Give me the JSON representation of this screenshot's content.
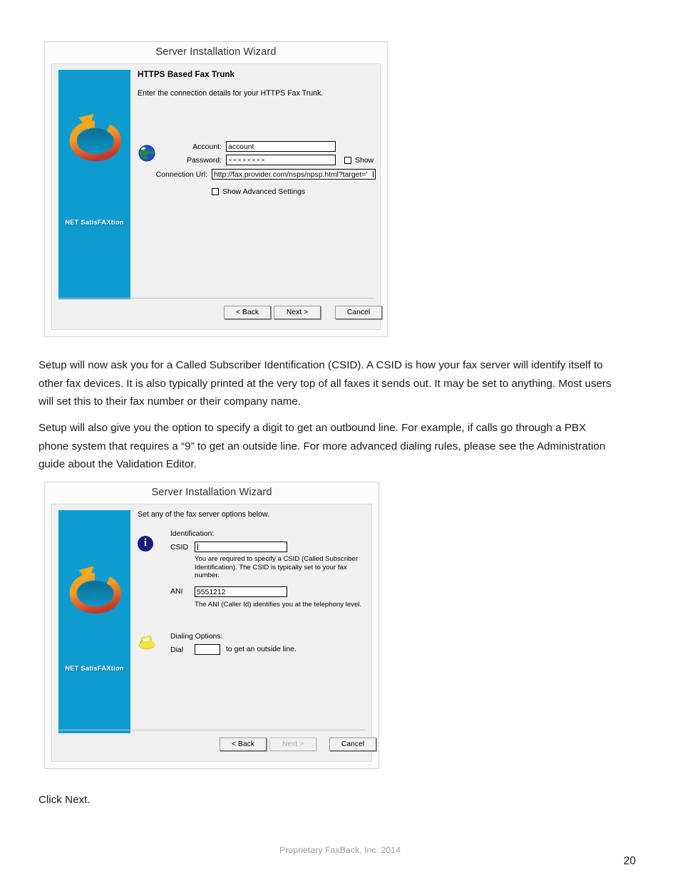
{
  "document": {
    "paragraph_1": "Setup will now ask you for a Called Subscriber Identification (CSID). A CSID is how your fax server will identify itself to other fax devices. It is also typically printed at the very top of all faxes it sends out. It may be set to anything. Most users will set this to their fax number or their company name.",
    "paragraph_2": "Setup will also give you the option to specify a digit to get an outbound line. For example, if calls go through a PBX phone system that requires a “9” to get an outside line. For more advanced dialing rules, please see the Administration guide about the Validation Editor.",
    "paragraph_3": "Click Next.",
    "footer": "Proprietary FaxBack, Inc. 2014",
    "page_number": "20"
  },
  "brand": {
    "name": "NET SatisFAXtion",
    "panel_color": "#0d9bd0",
    "logo_color_start": "#f5a623",
    "logo_color_end": "#c0392b"
  },
  "wizard_1": {
    "title": "Server Installation Wizard",
    "heading": "HTTPS Based Fax Trunk",
    "description": "Enter the connection details for your HTTPS Fax Trunk.",
    "icon": "globe-icon",
    "fields": {
      "account_label": "Account:",
      "account_value": "account",
      "password_label": "Password:",
      "password_value": "××××××××",
      "show_label": "Show",
      "show_checked": false,
      "connection_url_label": "Connection Url:",
      "connection_url_value": "http://fax.provider.com/nsps/npsp.html?target='",
      "advanced_label": "Show Advanced Settings",
      "advanced_checked": false
    },
    "buttons": {
      "back": "< Back",
      "next": "Next >",
      "cancel": "Cancel",
      "next_disabled": false
    }
  },
  "wizard_2": {
    "title": "Server Installation Wizard",
    "description": "Set any of the fax server options below.",
    "identification": {
      "icon": "info-icon",
      "section_label": "Identification:",
      "csid_label": "CSID",
      "csid_value": "",
      "csid_hint": "You are required to specify a CSID (Called Subscriber Identification). The CSID is typically set to your fax number.",
      "ani_label": "ANI",
      "ani_value": "5551212",
      "ani_hint": "The ANI (Caller Id) identifies you at the telephony level."
    },
    "dialing": {
      "icon": "telephone-icon",
      "section_label": "Dialing Options:",
      "dial_prefix_label": "Dial",
      "dial_value": "",
      "dial_suffix_label": "to get an outside line."
    },
    "buttons": {
      "back": "< Back",
      "next": "Next >",
      "cancel": "Cancel",
      "next_disabled": true
    }
  }
}
